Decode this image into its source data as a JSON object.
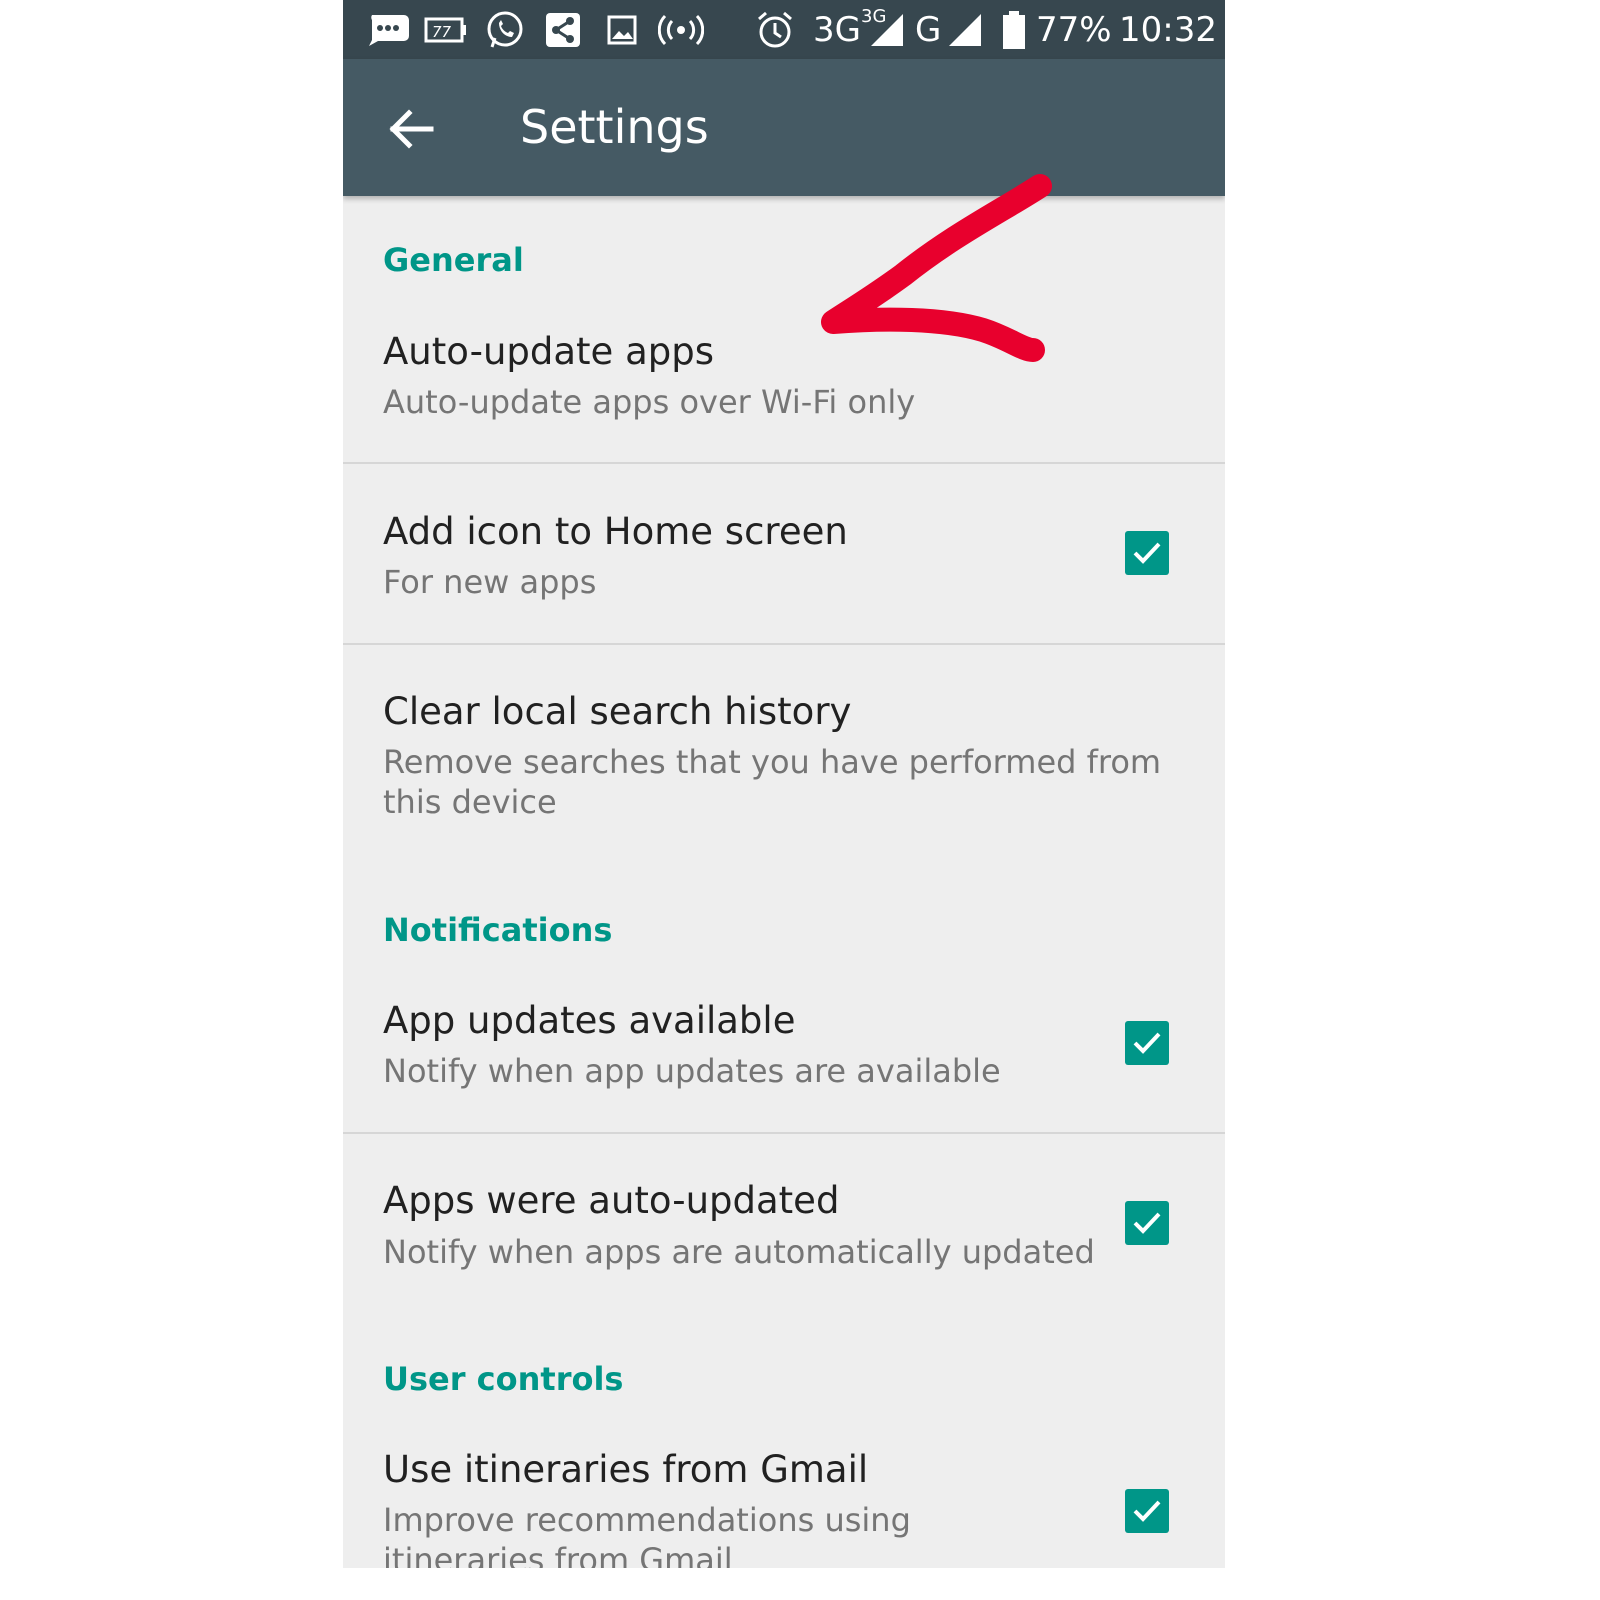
{
  "status_bar": {
    "network_3g": "3G",
    "network_3g_small": "3G",
    "network_g": "G",
    "battery": "77%",
    "time": "10:32",
    "icons": [
      "messaging-icon",
      "battery-saver-icon",
      "whatsapp-icon",
      "share-icon",
      "gallery-icon",
      "hotspot-icon",
      "alarm-icon",
      "signal-icon",
      "battery-icon"
    ]
  },
  "app_bar": {
    "title": "Settings",
    "back_icon": "arrow-left-icon"
  },
  "sections": [
    {
      "header": "General",
      "items": [
        {
          "title": "Auto-update apps",
          "subtitle": "Auto-update apps over Wi-Fi only"
        },
        {
          "title": "Add icon to Home screen",
          "subtitle": "For new apps",
          "checked": true
        },
        {
          "title": "Clear local search history",
          "subtitle": "Remove searches that you have performed from this device"
        }
      ]
    },
    {
      "header": "Notifications",
      "items": [
        {
          "title": "App updates available",
          "subtitle": "Notify when app updates are available",
          "checked": true
        },
        {
          "title": "Apps were auto-updated",
          "subtitle": "Notify when apps are automatically updated",
          "checked": true
        }
      ]
    },
    {
      "header": "User controls",
      "items": [
        {
          "title": "Use itineraries from Gmail",
          "subtitle": "Improve recommendations using itineraries from Gmail",
          "checked": true
        }
      ]
    }
  ],
  "colors": {
    "status_bar": "#37474f",
    "app_bar": "#455a64",
    "accent": "#009688",
    "background": "#eeeeee",
    "annotation": "#e8002d"
  }
}
